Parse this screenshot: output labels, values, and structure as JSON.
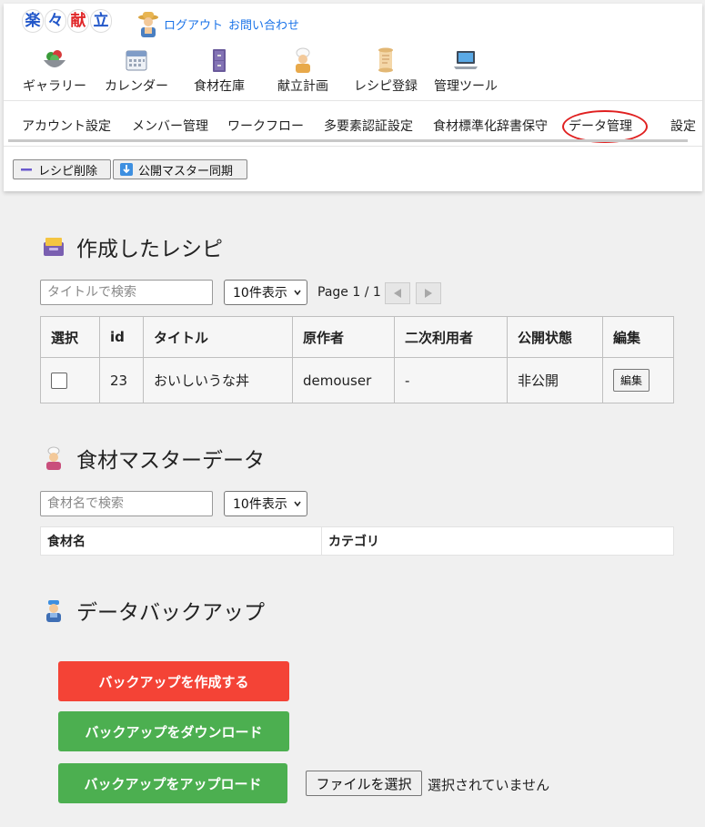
{
  "header": {
    "logo_chars": [
      "楽",
      "々",
      "献",
      "立"
    ],
    "logo_colors": [
      "#2257c9",
      "#2257c9",
      "#e0282a",
      "#2257c9"
    ],
    "logout_label": "ログアウト",
    "contact_label": "お問い合わせ",
    "link_color": "#1a73e8"
  },
  "nav": {
    "items": [
      {
        "label": "ギャラリー",
        "icon": "salad-bowl-icon"
      },
      {
        "label": "カレンダー",
        "icon": "calendar-icon"
      },
      {
        "label": "食材在庫",
        "icon": "cabinet-icon"
      },
      {
        "label": "献立計画",
        "icon": "chef-icon"
      },
      {
        "label": "レシピ登録",
        "icon": "scroll-icon"
      },
      {
        "label": "管理ツール",
        "icon": "laptop-icon"
      }
    ]
  },
  "subnav": {
    "items": [
      "アカウント設定",
      "メンバー管理",
      "ワークフロー",
      "多要素認証設定",
      "食材標準化辞書保守",
      "データ管理",
      "設定"
    ],
    "highlighted": "データ管理",
    "highlight_color": "#e02020"
  },
  "toolbar": {
    "delete_label": "レシピ削除",
    "sync_label": "公開マスター同期"
  },
  "recipes": {
    "title": "作成したレシピ",
    "search_placeholder": "タイトルで検索",
    "page_size": "10件表示",
    "page_info": "Page 1 / 1",
    "columns": [
      "選択",
      "id",
      "タイトル",
      "原作者",
      "二次利用者",
      "公開状態",
      "編集"
    ],
    "rows": [
      {
        "id": "23",
        "title": "おいしいうな丼",
        "author": "demouser",
        "secondary": "-",
        "status": "非公開",
        "edit_label": "編集"
      }
    ]
  },
  "ingredients": {
    "title": "食材マスターデータ",
    "search_placeholder": "食材名で検索",
    "page_size": "10件表示",
    "columns": [
      "食材名",
      "カテゴリ"
    ]
  },
  "backup": {
    "title": "データバックアップ",
    "create_label": "バックアップを作成する",
    "download_label": "バックアップをダウンロード",
    "upload_label": "バックアップをアップロード",
    "file_button": "ファイルを選択",
    "file_status": "選択されていません",
    "create_color": "#f44336",
    "green_color": "#4caf50"
  }
}
